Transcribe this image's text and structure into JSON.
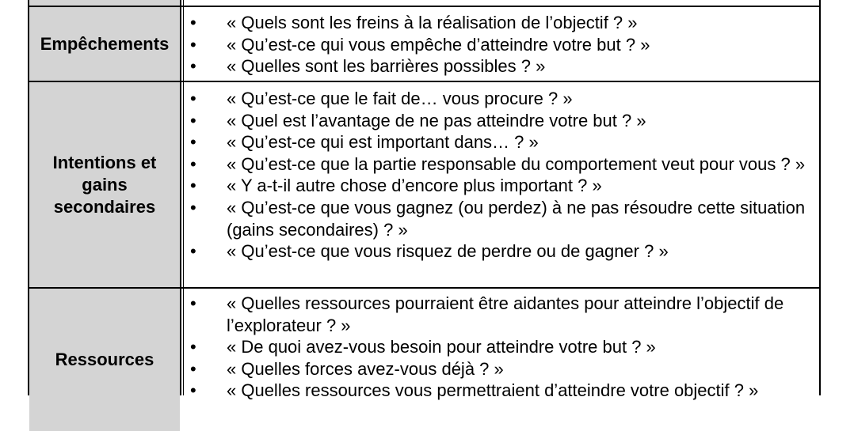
{
  "rows": [
    {
      "label": "Empêchements",
      "items": [
        "« Quels sont les freins à la réalisation de l’objectif ? »",
        "« Qu’est-ce qui vous empêche d’atteindre votre but ? »",
        "« Quelles sont les barrières possibles ? »"
      ]
    },
    {
      "label": "Intentions et gains secondaires",
      "items": [
        "« Qu’est-ce que le fait de… vous procure ? »",
        "« Quel est l’avantage de ne pas atteindre votre but ? »",
        "« Qu’est-ce qui est important dans… ? »",
        "« Qu’est-ce que la partie responsable du comportement veut pour vous ? »",
        "« Y a-t-il autre chose d’encore plus important ? »",
        "« Qu’est-ce que vous gagnez (ou perdez) à ne pas résoudre cette situation (gains secondaires) ? »",
        "« Qu’est-ce que vous risquez de perdre ou de gagner ? »"
      ]
    },
    {
      "label": "Ressources",
      "items": [
        "« Quelles ressources pourraient être aidantes pour atteindre l’objectif de l’explorateur ? »",
        "« De quoi avez-vous besoin pour atteindre votre but ? »",
        "« Quelles forces avez-vous déjà ? »",
        "« Quelles ressources vous permettraient d’atteindre votre objectif ? »"
      ]
    }
  ]
}
